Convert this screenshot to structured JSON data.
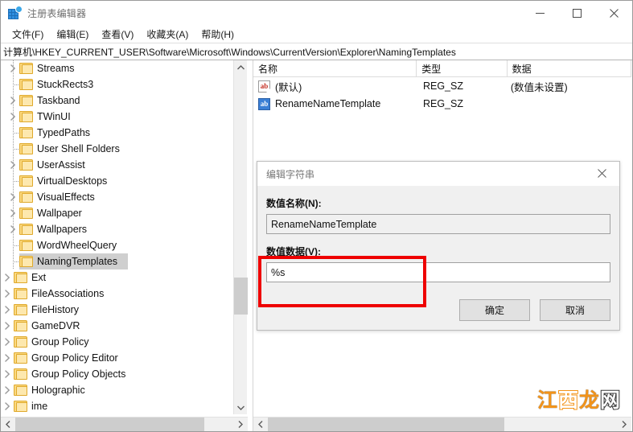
{
  "window": {
    "title": "注册表编辑器",
    "icon": "registry-editor-icon",
    "minimize_label": "—",
    "maximize_label": "□",
    "close_label": "✕"
  },
  "menu": {
    "items": [
      {
        "label": "文件(F)",
        "name": "menu-file"
      },
      {
        "label": "编辑(E)",
        "name": "menu-edit"
      },
      {
        "label": "查看(V)",
        "name": "menu-view"
      },
      {
        "label": "收藏夹(A)",
        "name": "menu-favorites"
      },
      {
        "label": "帮助(H)",
        "name": "menu-help"
      }
    ]
  },
  "address": {
    "path": "计算机\\HKEY_CURRENT_USER\\Software\\Microsoft\\Windows\\CurrentVersion\\Explorer\\NamingTemplates"
  },
  "tree": {
    "selected": "NamingTemplates",
    "nodes": [
      {
        "label": "Streams",
        "indent": 5,
        "expandable": true,
        "selected": false
      },
      {
        "label": "StuckRects3",
        "indent": 5,
        "expandable": false,
        "selected": false
      },
      {
        "label": "Taskband",
        "indent": 5,
        "expandable": true,
        "selected": false
      },
      {
        "label": "TWinUI",
        "indent": 5,
        "expandable": true,
        "selected": false
      },
      {
        "label": "TypedPaths",
        "indent": 5,
        "expandable": false,
        "selected": false
      },
      {
        "label": "User Shell Folders",
        "indent": 5,
        "expandable": false,
        "selected": false
      },
      {
        "label": "UserAssist",
        "indent": 5,
        "expandable": true,
        "selected": false
      },
      {
        "label": "VirtualDesktops",
        "indent": 5,
        "expandable": false,
        "selected": false
      },
      {
        "label": "VisualEffects",
        "indent": 5,
        "expandable": true,
        "selected": false
      },
      {
        "label": "Wallpaper",
        "indent": 5,
        "expandable": true,
        "selected": false
      },
      {
        "label": "Wallpapers",
        "indent": 5,
        "expandable": true,
        "selected": false
      },
      {
        "label": "WordWheelQuery",
        "indent": 5,
        "expandable": false,
        "selected": false
      },
      {
        "label": "NamingTemplates",
        "indent": 5,
        "expandable": false,
        "selected": true
      },
      {
        "label": "Ext",
        "indent": 4,
        "expandable": true,
        "selected": false
      },
      {
        "label": "FileAssociations",
        "indent": 4,
        "expandable": true,
        "selected": false
      },
      {
        "label": "FileHistory",
        "indent": 4,
        "expandable": true,
        "selected": false
      },
      {
        "label": "GameDVR",
        "indent": 4,
        "expandable": true,
        "selected": false
      },
      {
        "label": "Group Policy",
        "indent": 4,
        "expandable": true,
        "selected": false
      },
      {
        "label": "Group Policy Editor",
        "indent": 4,
        "expandable": true,
        "selected": false
      },
      {
        "label": "Group Policy Objects",
        "indent": 4,
        "expandable": true,
        "selected": false
      },
      {
        "label": "Holographic",
        "indent": 4,
        "expandable": true,
        "selected": false
      },
      {
        "label": "ime",
        "indent": 4,
        "expandable": true,
        "selected": false
      }
    ]
  },
  "values": {
    "columns": [
      {
        "label": "名称",
        "name": "column-name"
      },
      {
        "label": "类型",
        "name": "column-type"
      },
      {
        "label": "数据",
        "name": "column-data"
      }
    ],
    "rows": [
      {
        "name": "(默认)",
        "type": "REG_SZ",
        "data": "(数值未设置)",
        "icon": "string-default-icon"
      },
      {
        "name": "RenameNameTemplate",
        "type": "REG_SZ",
        "data": "",
        "icon": "string-value-icon"
      }
    ]
  },
  "dialog": {
    "title": "编辑字符串",
    "close_label": "✕",
    "name_label": "数值名称(N):",
    "name_value": "RenameNameTemplate",
    "data_label": "数值数据(V):",
    "data_value": "%s",
    "data_placeholder": "",
    "ok_label": "确定",
    "cancel_label": "取消"
  },
  "annotation": {
    "color": "#ee0000",
    "target": "数值数据输入框"
  },
  "watermark": {
    "part1": "江",
    "part2": "西",
    "part3": "龙",
    "part4": "网"
  }
}
